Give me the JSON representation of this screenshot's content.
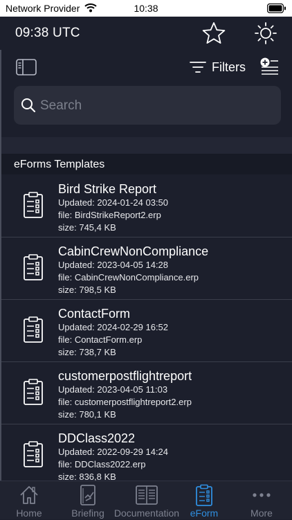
{
  "status_bar": {
    "carrier": "Network Provider",
    "time": "10:38"
  },
  "header": {
    "utc_time": "09:38 UTC",
    "icons": [
      "star-icon",
      "sun-icon"
    ]
  },
  "toolbar": {
    "filters_label": "Filters",
    "icons": [
      "sidebar-toggle-icon",
      "filter-lines-icon",
      "add-list-icon"
    ]
  },
  "search": {
    "placeholder": "Search",
    "value": ""
  },
  "section": {
    "title": "eForms Templates"
  },
  "templates": [
    {
      "name": "Bird Strike Report",
      "updated": "Updated: 2024-01-24 03:50",
      "file": "file: BirdStrikeReport2.erp",
      "size": "size: 745,4 KB"
    },
    {
      "name": "CabinCrewNonCompliance",
      "updated": "Updated: 2023-04-05 14:28",
      "file": "file: CabinCrewNonCompliance.erp",
      "size": "size: 798,5 KB"
    },
    {
      "name": "ContactForm",
      "updated": "Updated: 2024-02-29 16:52",
      "file": "file: ContactForm.erp",
      "size": "size: 738,7 KB"
    },
    {
      "name": "customerpostflightreport",
      "updated": "Updated: 2023-04-05 11:03",
      "file": "file: customerpostflightreport2.erp",
      "size": "size: 780,1 KB"
    },
    {
      "name": "DDClass2022",
      "updated": "Updated: 2022-09-29 14:24",
      "file": "file: DDClass2022.erp",
      "size": "size: 836,8 KB"
    }
  ],
  "tabs": [
    {
      "label": "Home",
      "icon": "home-icon",
      "active": false
    },
    {
      "label": "Briefing",
      "icon": "briefing-icon",
      "active": false
    },
    {
      "label": "Documentation",
      "icon": "documentation-icon",
      "active": false
    },
    {
      "label": "eForm",
      "icon": "eform-icon",
      "active": true
    },
    {
      "label": "More",
      "icon": "more-icon",
      "active": false
    }
  ],
  "colors": {
    "background": "#1c1f2c",
    "accent": "#2f8fe0",
    "tab_inactive": "#7e8290",
    "search_field": "#2b2e3b"
  }
}
